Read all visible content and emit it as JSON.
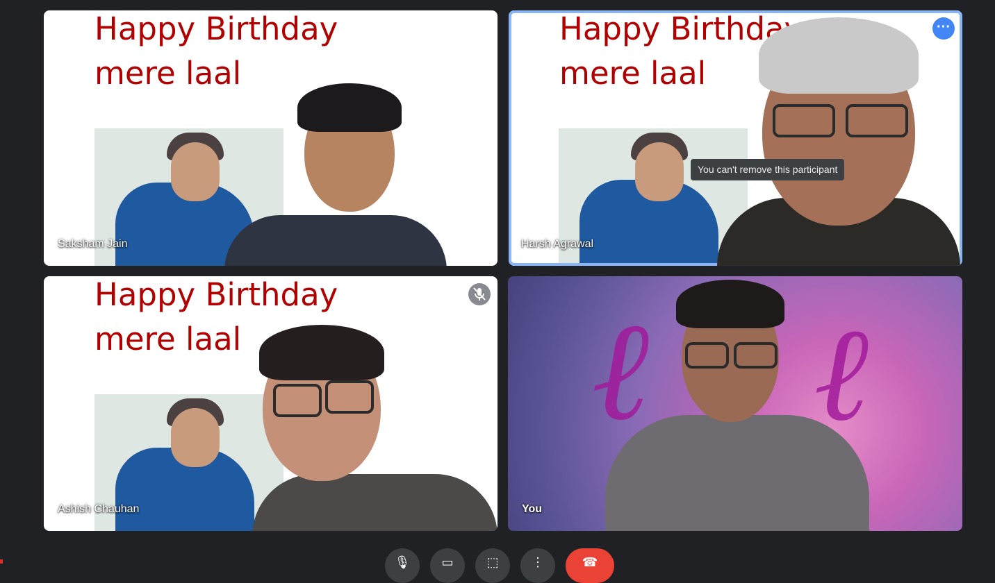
{
  "participants": [
    {
      "name": "Saksham Jain"
    },
    {
      "name": "Harsh Agrawal"
    },
    {
      "name": "Ashish Chauhan"
    },
    {
      "name": "You"
    }
  ],
  "background_text": {
    "line1": "Happy Birthday",
    "line2": "mere laal"
  },
  "tooltip": "You can't remove this participant",
  "icons": {
    "more_options": "more-horiz-icon",
    "muted": "mic-off-icon",
    "mic": "mic-icon",
    "camera": "videocam-icon",
    "present": "present-screen-icon",
    "more": "more-vert-icon",
    "end_call": "call-end-icon"
  },
  "colors": {
    "background": "#202124",
    "active_speaker_border": "#8ab4f8",
    "more_button": "#4285f4",
    "end_call": "#ea4335",
    "birthday_text": "#b00000"
  }
}
